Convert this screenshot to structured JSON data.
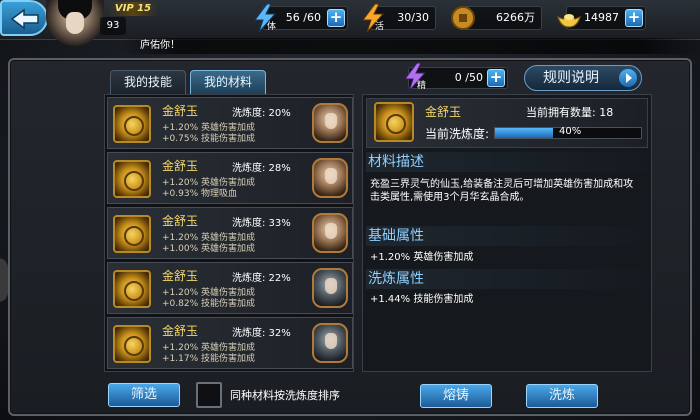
{
  "header": {
    "vip": "VIP 15",
    "level": "93",
    "marquee": "庐佑你！",
    "stats": [
      {
        "label": "体",
        "value": "56 /60",
        "color": "#4aa8e8"
      },
      {
        "label": "活",
        "value": "30/30",
        "color": "#f0a020"
      },
      {
        "label": "coin",
        "value": "6266万",
        "color": "#d8a030"
      },
      {
        "label": "gold",
        "value": "14987",
        "color": "#f0c040"
      }
    ]
  },
  "tabs": [
    {
      "label": "我的技能",
      "active": false
    },
    {
      "label": "我的材料",
      "active": true
    }
  ],
  "refine_points": {
    "label": "精",
    "value": "0 /50"
  },
  "rules_button": "规则说明",
  "items": [
    {
      "name": "金舒玉",
      "refine": "洗炼度: 20%",
      "line1": "+1.20% 英雄伤害加成",
      "line2": "+0.75% 技能伤害加成"
    },
    {
      "name": "金舒玉",
      "refine": "洗炼度: 28%",
      "line1": "+1.20% 英雄伤害加成",
      "line2": "+0.93% 物理吸血"
    },
    {
      "name": "金舒玉",
      "refine": "洗炼度: 33%",
      "line1": "+1.20% 英雄伤害加成",
      "line2": "+1.00% 英雄伤害加成"
    },
    {
      "name": "金舒玉",
      "refine": "洗炼度: 22%",
      "line1": "+1.20% 英雄伤害加成",
      "line2": "+0.82% 技能伤害加成"
    },
    {
      "name": "金舒玉",
      "refine": "洗炼度: 32%",
      "line1": "+1.20% 英雄伤害加成",
      "line2": "+1.17% 技能伤害加成"
    }
  ],
  "filter_button": "筛选",
  "sort_label": "同种材料按洗炼度排序",
  "detail": {
    "name": "金舒玉",
    "count": "当前拥有数量: 18",
    "refine_label": "当前洗炼度:",
    "refine_pct": "40%",
    "refine_value": 0.4,
    "desc_title": "材料描述",
    "desc": "充盈三界灵气的仙玉,给装备注灵后可增加英雄伤害加成和攻击类属性,需使用3个月华玄晶合成。",
    "base_title": "基础属性",
    "base": "+1.20% 英雄伤害加成",
    "refine_title": "洗炼属性",
    "refine_attr": "+1.44% 技能伤害加成"
  },
  "actions": {
    "forge": "熔铸",
    "wash": "洗炼"
  }
}
